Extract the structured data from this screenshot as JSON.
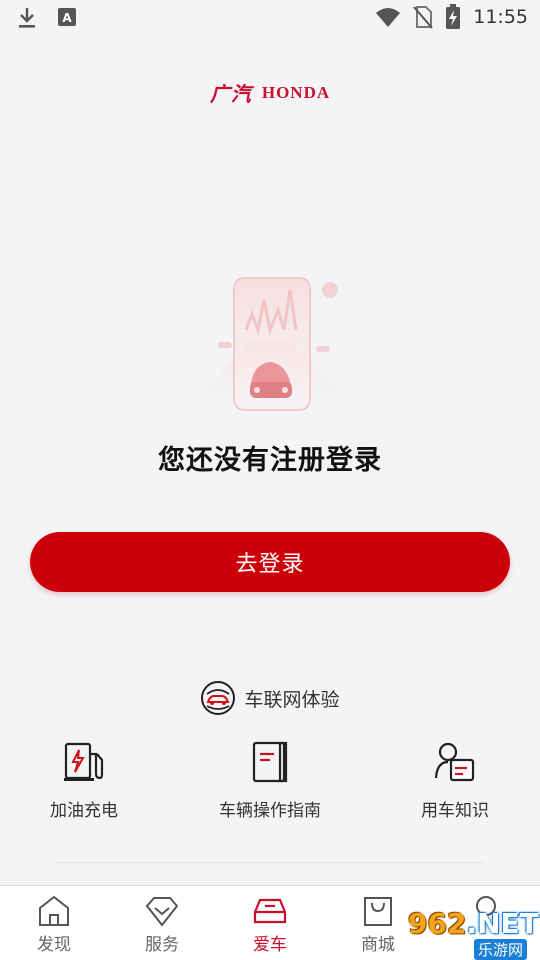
{
  "status_bar": {
    "time": "11:55",
    "left_icons": [
      "download-icon",
      "a-notification-icon"
    ],
    "right_icons": [
      "wifi-icon",
      "no-sim-icon",
      "battery-charging-icon"
    ]
  },
  "brand": {
    "gac_text": "广汽",
    "honda_text": "HONDA",
    "color": "#c8102e"
  },
  "main": {
    "title": "您还没有注册登录",
    "login_button_label": "去登录"
  },
  "iov": {
    "label": "车联网体验",
    "icon": "connected-car-icon"
  },
  "features": [
    {
      "label": "加油充电",
      "icon": "fuel-charge-icon"
    },
    {
      "label": "车辆操作指南",
      "icon": "manual-book-icon"
    },
    {
      "label": "用车知识",
      "icon": "knowledge-card-icon"
    }
  ],
  "tabs": [
    {
      "label": "发现",
      "icon": "home-icon",
      "active": false
    },
    {
      "label": "服务",
      "icon": "diamond-icon",
      "active": false
    },
    {
      "label": "爱车",
      "icon": "car-icon",
      "active": true
    },
    {
      "label": "商城",
      "icon": "shopping-bag-icon",
      "active": false
    },
    {
      "label": "",
      "icon": "user-icon",
      "active": false
    }
  ],
  "watermark": {
    "main_prefix": "962",
    "main_suffix": ".NET",
    "sub": "乐游网"
  },
  "colors": {
    "accent": "#cc0008",
    "background": "#f4f4f6",
    "tab_active": "#c8102e"
  }
}
